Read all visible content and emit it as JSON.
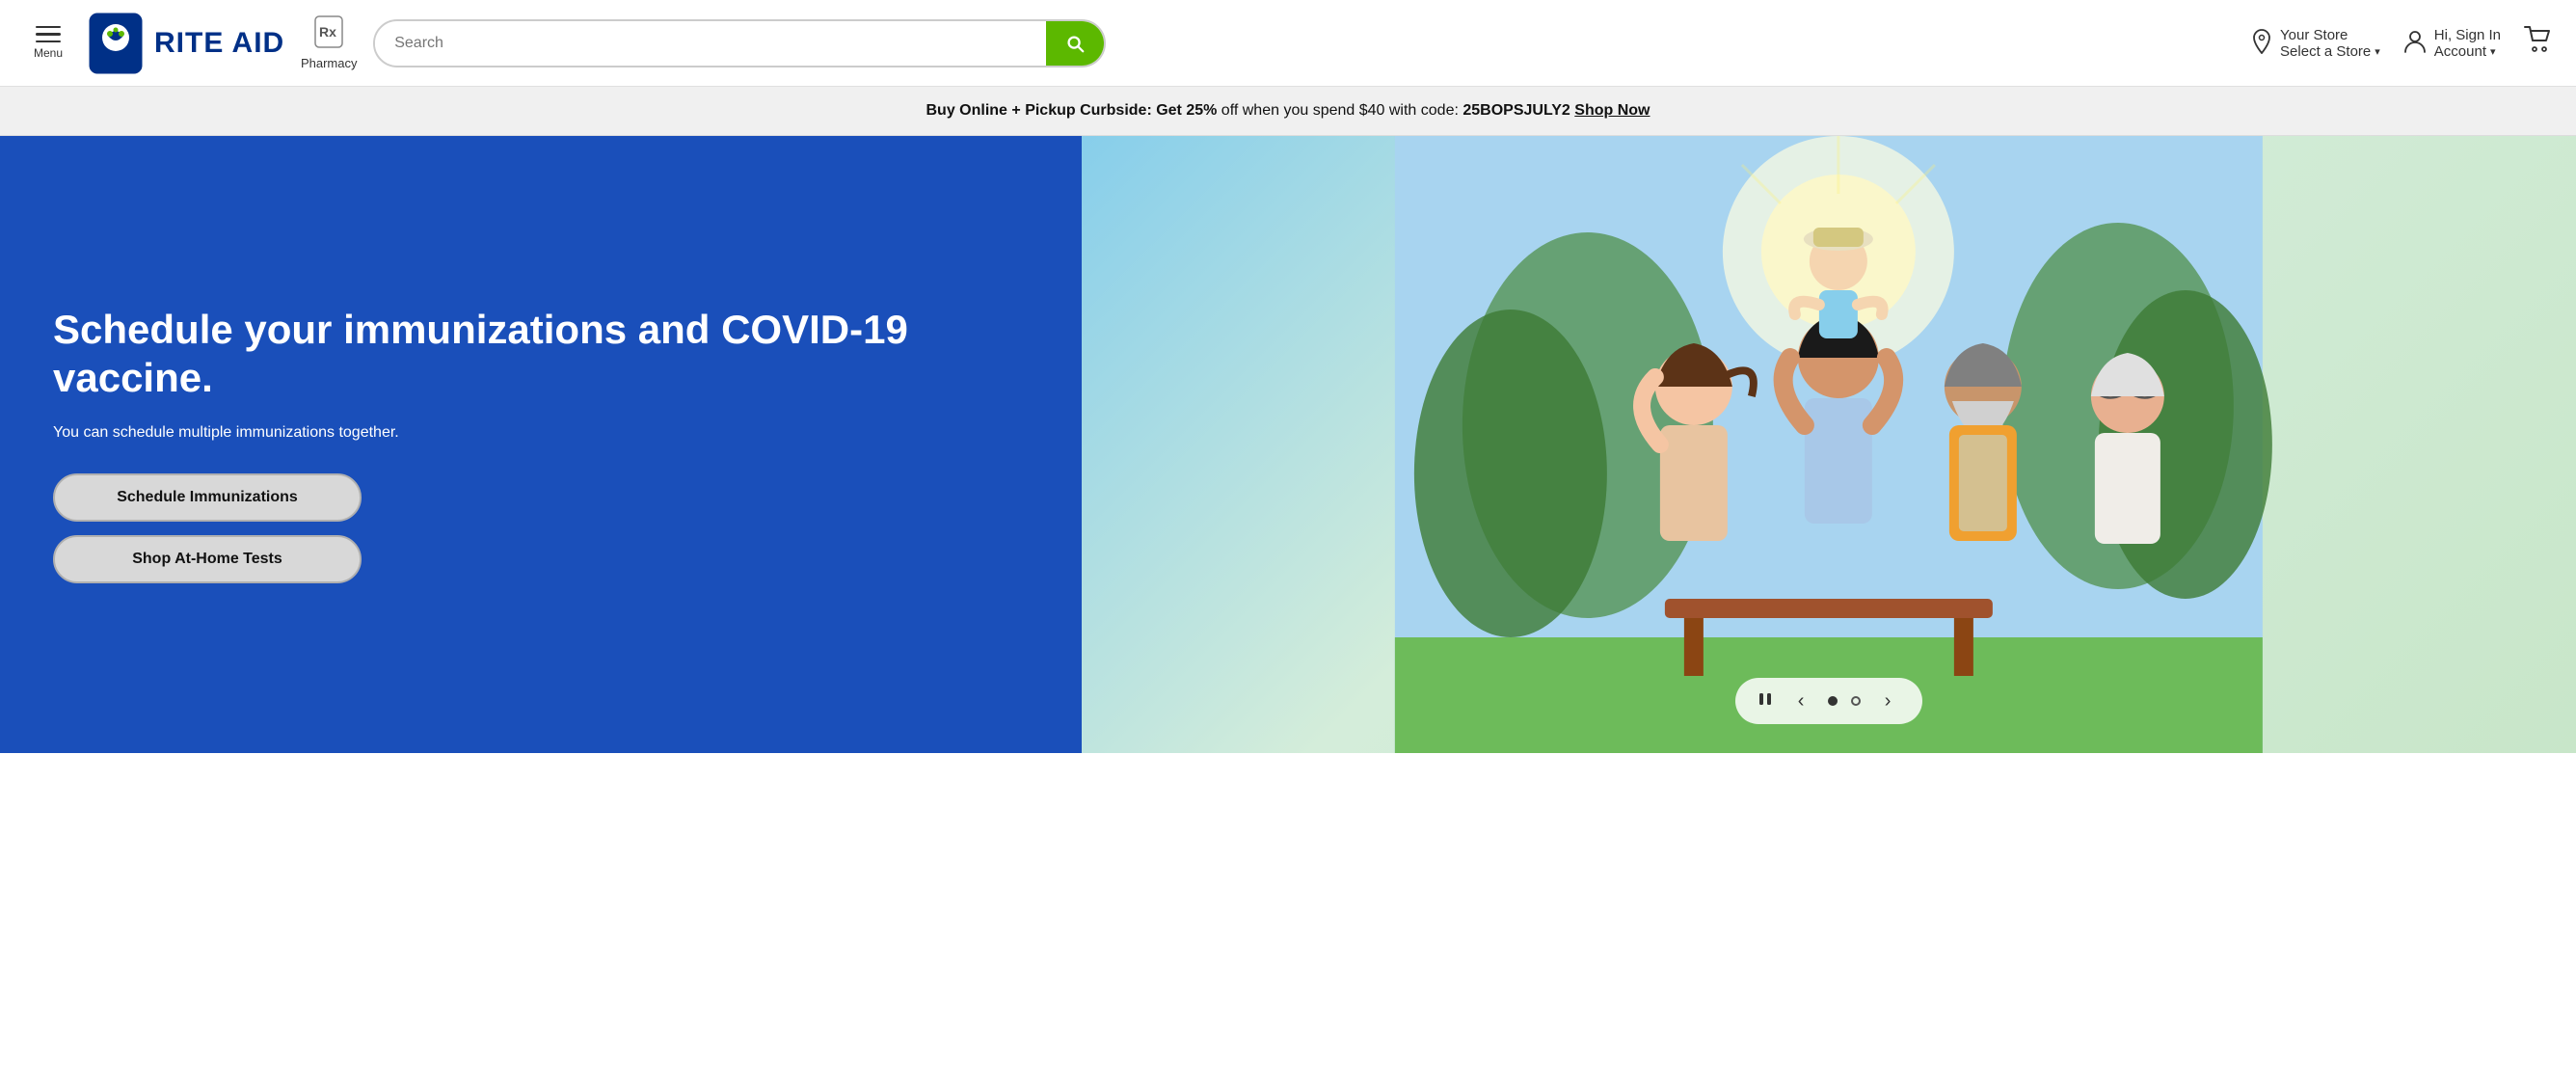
{
  "header": {
    "menu_label": "Menu",
    "logo_brand": "RITE AID",
    "pharmacy_label": "Pharmacy",
    "search_placeholder": "Search",
    "store_top": "Your Store",
    "store_bottom": "Select a Store",
    "account_top": "Hi, Sign In",
    "account_bottom": "Account",
    "search_button_label": "Search"
  },
  "promo": {
    "text_part1": "Buy Online + Pickup Curbside: Get 25%",
    "text_part2": " off when you spend $40 with code: ",
    "code": "25BOPSJULY2",
    "shop_now": "Shop Now"
  },
  "hero": {
    "headline": "Schedule your immunizations and COVID-19 vaccine.",
    "subtext": "You can schedule multiple immunizations together.",
    "btn1": "Schedule Immunizations",
    "btn2": "Shop At-Home Tests"
  },
  "carousel": {
    "prev_label": "‹",
    "next_label": "›",
    "pause_label": "⏸"
  }
}
